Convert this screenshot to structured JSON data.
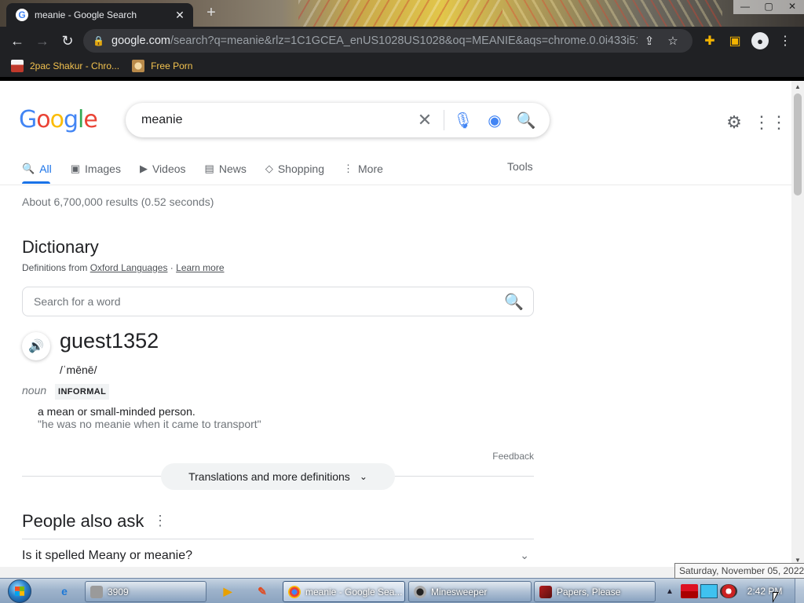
{
  "browser": {
    "tab_title": "meanie - Google Search",
    "tab_favicon": "G",
    "tab_close": "✕",
    "new_tab": "+",
    "window_controls": [
      "—",
      "▢",
      "✕"
    ],
    "url_host": "google.com",
    "url_rest": "/search?q=meanie&rlz=1C1GCEA_enUS1028US1028&oq=MEANIE&aqs=chrome.0.0i433i512l2j...",
    "bookmarks": [
      "2pac Shakur - Chro...",
      "Free Porn"
    ]
  },
  "google": {
    "logo": [
      "G",
      "o",
      "o",
      "g",
      "l",
      "e"
    ],
    "logo_colors": [
      "#4285f4",
      "#ea4335",
      "#fbbc05",
      "#4285f4",
      "#34a853",
      "#ea4335"
    ],
    "query": "meanie",
    "tabs": [
      {
        "label": "All",
        "icon": "🔍"
      },
      {
        "label": "Images",
        "icon": "▣"
      },
      {
        "label": "Videos",
        "icon": "▶"
      },
      {
        "label": "News",
        "icon": "▤"
      },
      {
        "label": "Shopping",
        "icon": "◇"
      },
      {
        "label": "More",
        "icon": "⋮"
      }
    ],
    "tools": "Tools",
    "stats": "About 6,700,000 results (0.52 seconds)"
  },
  "dictionary": {
    "title": "Dictionary",
    "source_prefix": "Definitions from",
    "source_link": "Oxford Languages",
    "source_sep": " · ",
    "learn_more": "Learn more",
    "search_placeholder": "Search for a word",
    "headword": "guest1352",
    "phonetic": "/ˈmēnē/",
    "part_of_speech": "noun",
    "register": "INFORMAL",
    "definition": "a mean or small-minded person.",
    "example": "\"he was no meanie when it came to transport\"",
    "feedback": "Feedback",
    "more_button": "Translations and more definitions"
  },
  "people_also_ask": {
    "title": "People also ask",
    "questions": [
      "Is it spelled Meany or meanie?"
    ]
  },
  "taskbar": {
    "tasks": [
      "3909",
      "meanie - Google Sea...",
      "Minesweeper",
      "Papers, Please"
    ],
    "clock": "2:42 PM",
    "tooltip": "Saturday, November 05, 2022"
  }
}
